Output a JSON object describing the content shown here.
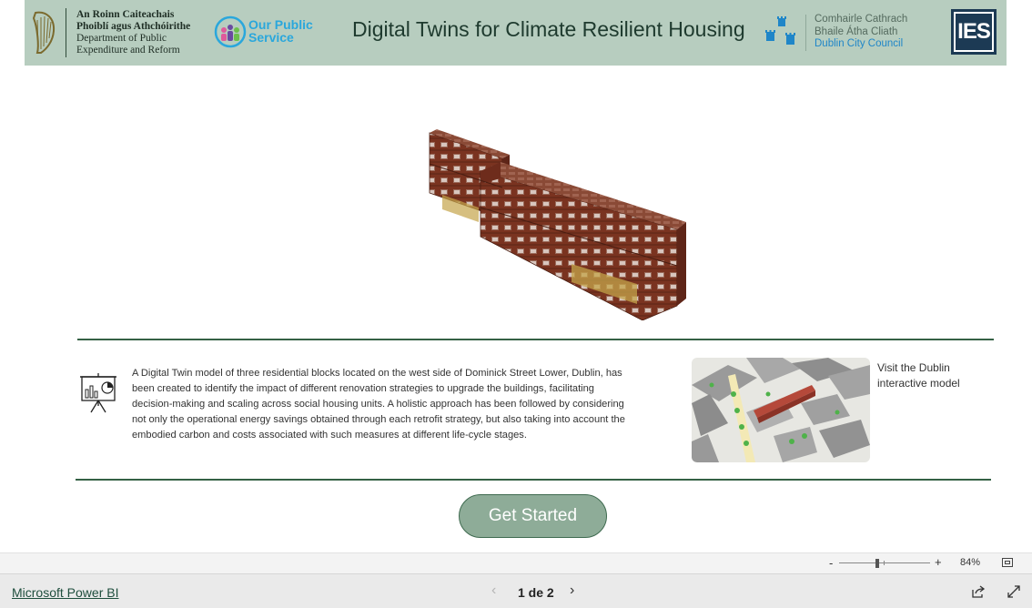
{
  "header": {
    "dept_lines": [
      "An Roinn Caiteachais",
      "Phoiblí agus Athchóirithe",
      "Department of Public",
      "Expenditure and Reform"
    ],
    "ops_lines": [
      "Our Public",
      "Service"
    ],
    "title": "Digital Twins for Climate Resilient Housing",
    "dcc_lines": [
      "Comhairle Cathrach",
      "Bhaile Átha Cliath",
      "Dublin City Council"
    ],
    "ies_label": "IES"
  },
  "main": {
    "description": "A Digital Twin model of three residential blocks located on the west side of Dominick Street Lower, Dublin, has been created to identify the impact of different renovation strategies to upgrade the buildings, facilitating decision-making and scaling across social housing units. A holistic approach has been followed by considering not only the operational energy savings obtained through each retrofit strategy, but also taking into account the embodied carbon and costs associated with such measures at different life-cycle stages.",
    "visit_text": "Visit the Dublin interactive model",
    "get_started_label": "Get Started"
  },
  "zoom": {
    "minus": "-",
    "plus": "+",
    "percent": "84%",
    "level": 0.84
  },
  "footer": {
    "app_link": "Microsoft Power BI",
    "page_indicator": "1 de 2",
    "prev_icon": "chevron-left-icon",
    "next_icon": "chevron-right-icon"
  },
  "colors": {
    "banner": "#b7cdbf",
    "accent_green": "#356145",
    "button": "#8eac98",
    "brick": "#7a3320"
  }
}
